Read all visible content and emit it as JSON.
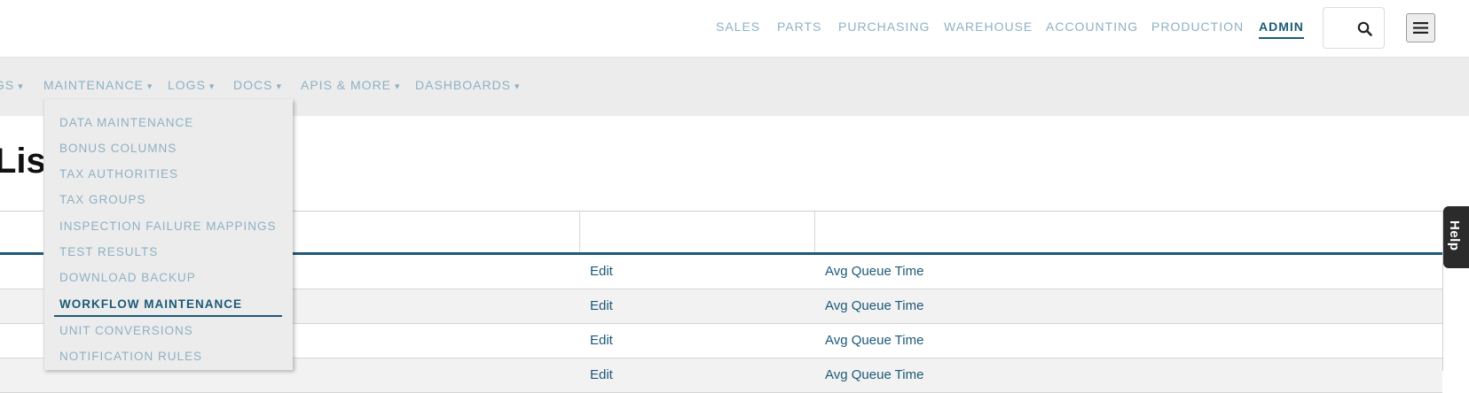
{
  "top_nav": {
    "items": [
      {
        "label": "SALES"
      },
      {
        "label": "PARTS"
      },
      {
        "label": "PURCHASING"
      },
      {
        "label": "WAREHOUSE"
      },
      {
        "label": "ACCOUNTING"
      },
      {
        "label": "PRODUCTION"
      },
      {
        "label": "ADMIN",
        "active": true
      }
    ],
    "search_icon": "search-icon",
    "menu_icon": "hamburger-menu-icon"
  },
  "sub_nav": {
    "items": [
      {
        "label": "GS"
      },
      {
        "label": "MAINTENANCE"
      },
      {
        "label": "LOGS"
      },
      {
        "label": "DOCS"
      },
      {
        "label": "APIS & MORE"
      },
      {
        "label": "DASHBOARDS"
      }
    ],
    "caret": "▾"
  },
  "dropdown": {
    "items": [
      {
        "label": "DATA MAINTENANCE"
      },
      {
        "label": "BONUS COLUMNS"
      },
      {
        "label": "TAX AUTHORITIES"
      },
      {
        "label": "TAX GROUPS"
      },
      {
        "label": "INSPECTION FAILURE MAPPINGS"
      },
      {
        "label": "TEST RESULTS"
      },
      {
        "label": "DOWNLOAD BACKUP"
      },
      {
        "label": "WORKFLOW MAINTENANCE",
        "active": true
      },
      {
        "label": "UNIT CONVERSIONS"
      },
      {
        "label": "NOTIFICATION RULES"
      }
    ]
  },
  "page": {
    "title": "List"
  },
  "table": {
    "rows": [
      {
        "action": "Edit",
        "name": "Avg Queue Time"
      },
      {
        "action": "Edit",
        "name": "Avg Queue Time"
      },
      {
        "action": "Edit",
        "name": "Avg Queue Time"
      },
      {
        "action": "Edit",
        "name": "Avg Queue Time"
      }
    ]
  },
  "help": {
    "label": "Help"
  },
  "colors": {
    "accent": "#1d5a78",
    "nav_text": "#8fb0c4",
    "subbar_bg": "#ececec"
  }
}
